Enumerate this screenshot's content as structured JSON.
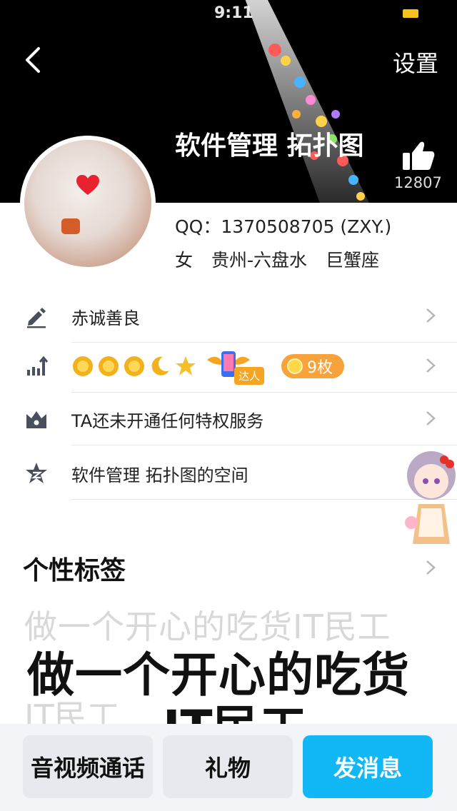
{
  "status_bar": {
    "time": "9:11",
    "battery_color": "#f7c21b"
  },
  "header": {
    "back_icon": "chevron-left-icon",
    "settings_label": "设置",
    "profile_name": "软件管理 拓扑图",
    "like_icon": "thumbs-up-icon",
    "like_count": "12807"
  },
  "profile": {
    "qq": "QQ：1370508705 (ZXY.)",
    "gender": "女",
    "location": "贵州-六盘水",
    "zodiac": "巨蟹座"
  },
  "rows": [
    {
      "icon": "pen-icon",
      "label": "赤诚善良"
    },
    {
      "icon": "level-chart-icon",
      "label": "",
      "badge_label": "达人",
      "coin_label": "9枚"
    },
    {
      "icon": "crown-icon",
      "label": "TA还未开通任何特权服务"
    },
    {
      "icon": "qzone-star-icon",
      "label": "软件管理 拓扑图的空间"
    }
  ],
  "tags": {
    "title": "个性标签",
    "background_text": "做一个开心的吃货IT民工",
    "main_line1": "做一个开心的吃货",
    "main_line2": "IT民工",
    "background_text2": "IT民工"
  },
  "bottom_bar": {
    "call_label": "音视频通话",
    "gift_label": "礼物",
    "message_label": "发消息",
    "accent_color": "#12b7f5"
  }
}
